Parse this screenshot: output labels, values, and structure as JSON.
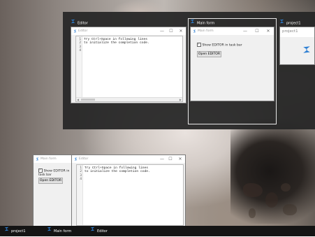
{
  "switcher": {
    "editor": {
      "label": "Editor",
      "window_title": "Editor",
      "line_numbers": [
        "1",
        "2",
        "3",
        "4"
      ],
      "code": "Try Ctrl+Space in following lines\nto initialize the completion code."
    },
    "main_form": {
      "label": "Main form",
      "window_title": "Main form",
      "checkbox_label": "Show EDITOR in task bar",
      "button_label": "Open EDITOR"
    },
    "project": {
      "label": "project1",
      "window_title": "project1"
    }
  },
  "desktop": {
    "main_form": {
      "title": "Main form",
      "checkbox_label": "Show EDITOR in task bar",
      "button_label": "Open EDITOR"
    },
    "editor": {
      "title": "Editor",
      "line_numbers": [
        "1",
        "2",
        "3",
        "4"
      ],
      "code": "Try Ctrl+Space in following lines\nto initialize the completion code."
    }
  },
  "taskbar": {
    "items": [
      {
        "label": "project1"
      },
      {
        "label": "Main form"
      },
      {
        "label": "Editor"
      }
    ]
  },
  "window_controls": {
    "minimize": "—",
    "maximize": "☐",
    "close": "✕"
  },
  "colors": {
    "accent": "#2d7fd3",
    "taskbar": "#141414",
    "switcher": "#262626"
  }
}
